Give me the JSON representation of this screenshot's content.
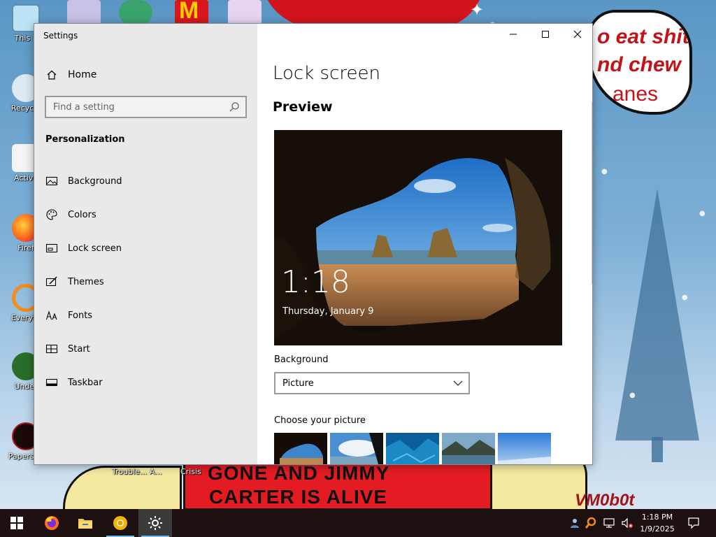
{
  "desktop": {
    "bubble_line1": "o eat shit",
    "bubble_line2": "nd chew",
    "bubble_line3": "anes",
    "banner_line1": "GONE AND JIMMY",
    "banner_line2": "CARTER IS ALIVE",
    "signature": "VM0b0t",
    "icons": [
      {
        "label": "This P",
        "icon": "computer-icon"
      },
      {
        "label": "Recycle",
        "icon": "recycle-bin-icon"
      },
      {
        "label": "Activa",
        "icon": "file-icon"
      },
      {
        "label": "Firef",
        "icon": "firefox-icon"
      },
      {
        "label": "Everyth",
        "icon": "everything-search-icon"
      },
      {
        "label": "Under",
        "icon": "undertale-icon"
      },
      {
        "label": "Papers, P",
        "icon": "papers-please-icon"
      }
    ],
    "bottom_labels": [
      "Trouble... A...",
      "Crisis"
    ]
  },
  "window": {
    "title": "Settings",
    "controls": {
      "minimize": "minimize",
      "maximize": "maximize",
      "close": "close"
    }
  },
  "nav": {
    "home_label": "Home",
    "search_placeholder": "Find a setting",
    "section_heading": "Personalization",
    "items": [
      {
        "label": "Background",
        "icon": "picture-icon"
      },
      {
        "label": "Colors",
        "icon": "palette-icon"
      },
      {
        "label": "Lock screen",
        "icon": "lock-screen-icon"
      },
      {
        "label": "Themes",
        "icon": "brush-icon"
      },
      {
        "label": "Fonts",
        "icon": "fonts-icon"
      },
      {
        "label": "Start",
        "icon": "start-grid-icon"
      },
      {
        "label": "Taskbar",
        "icon": "taskbar-icon"
      }
    ]
  },
  "main": {
    "page_title": "Lock screen",
    "preview_heading": "Preview",
    "preview_time": "1:18",
    "preview_date": "Thursday, January 9",
    "background_label": "Background",
    "background_value": "Picture",
    "choose_picture_label": "Choose your picture"
  },
  "taskbar": {
    "apps": [
      "start-icon",
      "firefox-icon",
      "file-explorer-icon",
      "chrome-canary-icon",
      "settings-gear-icon"
    ],
    "tray_time": "1:18 PM",
    "tray_date": "1/9/2025",
    "colors": {
      "accent": "#76b9ed",
      "taskbar": "#1c1010"
    }
  }
}
